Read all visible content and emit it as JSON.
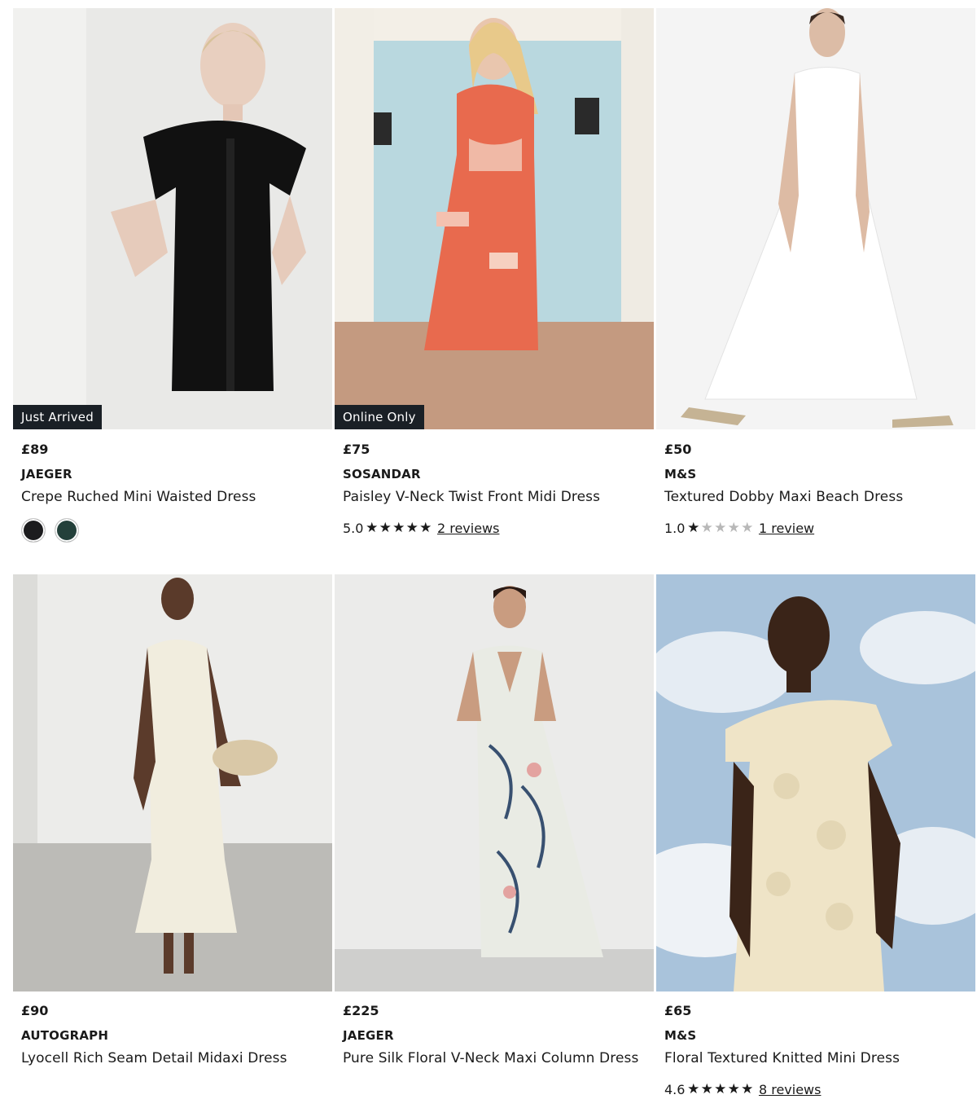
{
  "products": [
    {
      "price": "£89",
      "brand": "JAEGER",
      "title": "Crepe Ruched Mini Waisted Dress",
      "badge": "Just Arrived",
      "swatches": [
        {
          "name": "black",
          "color": "#1c1c1e"
        },
        {
          "name": "dark-green",
          "color": "#23403a"
        }
      ]
    },
    {
      "price": "£75",
      "brand": "SOSANDAR",
      "title": "Paisley V-Neck Twist Front Midi Dress",
      "badge": "Online Only",
      "rating": {
        "value": "5.0",
        "stars": 5,
        "reviews": "2 reviews"
      }
    },
    {
      "price": "£50",
      "brand": "M&S",
      "title": "Textured Dobby Maxi Beach Dress",
      "rating": {
        "value": "1.0",
        "stars": 1,
        "reviews": "1 review"
      }
    },
    {
      "price": "£90",
      "brand": "AUTOGRAPH",
      "title": "Lyocell Rich Seam Detail Midaxi Dress"
    },
    {
      "price": "£225",
      "brand": "JAEGER",
      "title": "Pure Silk Floral V-Neck Maxi Column Dress"
    },
    {
      "price": "£65",
      "brand": "M&S",
      "title": "Floral Textured Knitted Mini Dress",
      "rating": {
        "value": "4.6",
        "stars": 4.6,
        "reviews": "8 reviews"
      }
    }
  ],
  "icons": {
    "star": "star-icon"
  }
}
